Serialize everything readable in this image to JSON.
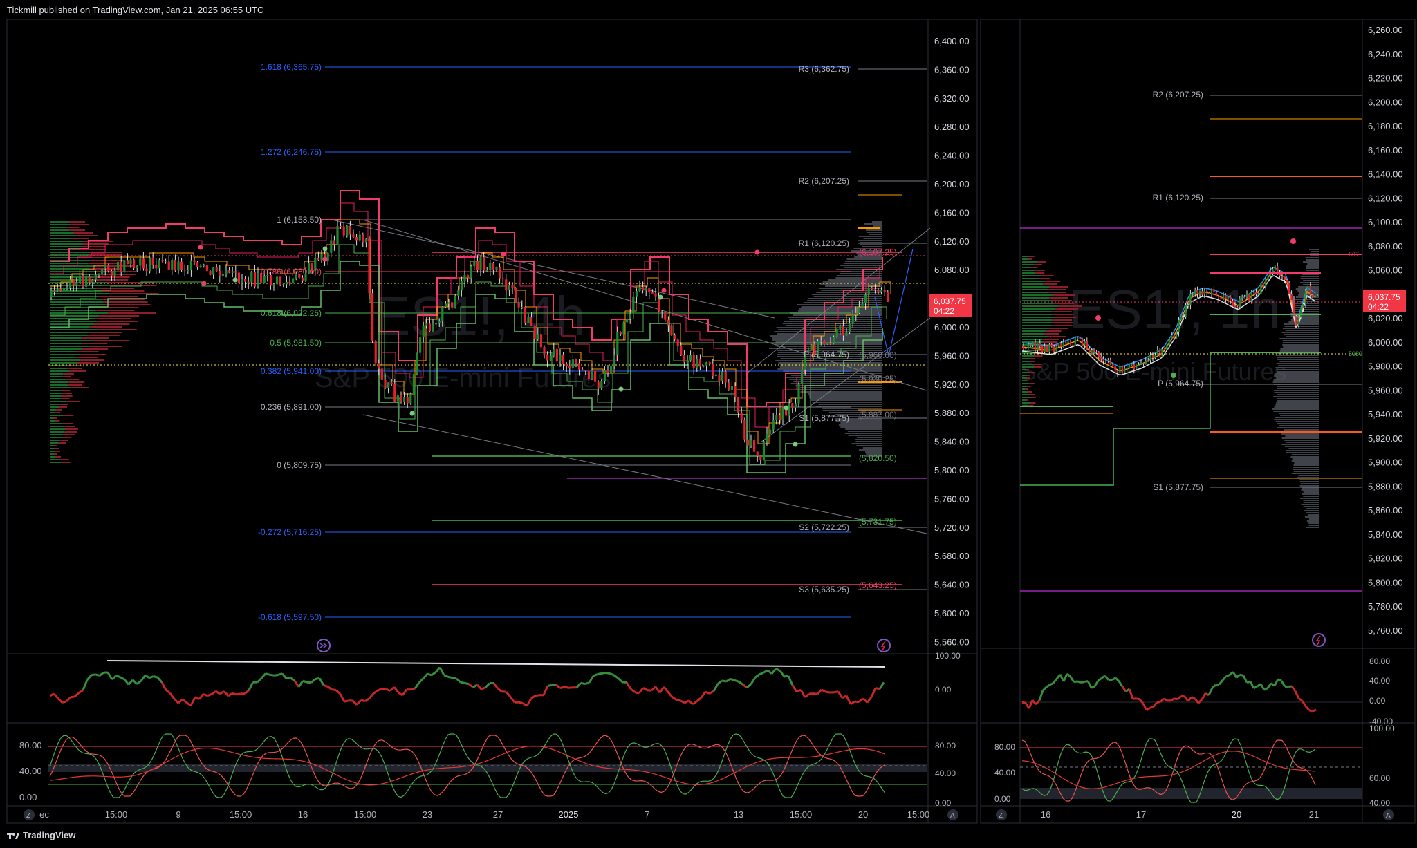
{
  "header": {
    "published_text": "Tickmill published on TradingView.com, Jan 21, 2025 06:55 UTC"
  },
  "footer": {
    "brand": "TradingView"
  },
  "colors": {
    "bull": "#1b8a2f",
    "bear": "#e8202e",
    "pink": "#f23b6b",
    "green_line": "#4caf50",
    "orange": "#ff9800",
    "blue": "#2962ff",
    "purple": "#9c27b0",
    "gray": "#787b86"
  },
  "left_chart": {
    "watermark_main": "ES1!, 4h",
    "watermark_sub": "S&P 500 E-mini Futures",
    "price_axis": [
      "6,400.00",
      "6,360.00",
      "6,320.00",
      "6,280.00",
      "6,240.00",
      "6,200.00",
      "6,160.00",
      "6,120.00",
      "6,080.00",
      "6,040.00",
      "6,000.00",
      "5,960.00",
      "5,920.00",
      "5,880.00",
      "5,840.00",
      "5,800.00",
      "5,760.00",
      "5,720.00",
      "5,680.00",
      "5,640.00",
      "5,600.00",
      "5,560.00"
    ],
    "last_price": "6,037.75",
    "countdown": "04:22",
    "fib_labels": [
      "1.618 (6,365.75)",
      "1.272 (6,246.75)",
      "1 (6,153.50)",
      "0.786 (6,080.00)",
      "0.618 (6,022.25)",
      "0.5 (5,981.50)",
      "0.382 (5,941.00)",
      "0.236 (5,891.00)",
      "0 (5,809.75)",
      "-0.272 (5,716.25)",
      "-0.618 (5,597.50)"
    ],
    "pivot_labels": [
      "R3 (6,362.75)",
      "R2 (6,207.25)",
      "R1 (6,120.25)",
      "P (5,964.75)",
      "S1 (5,877.75)",
      "S2 (5,722.25)",
      "S3 (5,635.25)"
    ],
    "level_labels": [
      "(6,107.25)",
      "(5,960.00)",
      "(5,930.25)",
      "(5,887.00)",
      "(5,820.50)",
      "(5,731.75)",
      "(5,643.25)"
    ],
    "time_axis": [
      "ec",
      "15:00",
      "9",
      "15:00",
      "16",
      "15:00",
      "23",
      "27",
      "2025",
      "7",
      "13",
      "15:00",
      "20",
      "15:00"
    ],
    "osc1_axis": [
      "100.00",
      "0.00"
    ],
    "osc2_axis": [
      "80.00",
      "40.00",
      "0.00",
      "80.00",
      "40.00",
      "0.00"
    ]
  },
  "right_chart": {
    "watermark_main": "ES1!, 1h",
    "watermark_sub": "S&P 500 E-mini Futures",
    "price_axis": [
      "6,260.00",
      "6,240.00",
      "6,220.00",
      "6,200.00",
      "6,180.00",
      "6,160.00",
      "6,140.00",
      "6,120.00",
      "6,100.00",
      "6,080.00",
      "6,060.00",
      "6,040.00",
      "6,020.00",
      "6,000.00",
      "5,980.00",
      "5,960.00",
      "5,940.00",
      "5,920.00",
      "5,900.00",
      "5,880.00",
      "5,860.00",
      "5,840.00",
      "5,820.00",
      "5,800.00",
      "5,780.00",
      "5,760.00"
    ],
    "last_price": "6,037.75",
    "countdown": "04:22",
    "pivot_labels": [
      "R2 (6,207.25)",
      "R1 (6,120.25)",
      "P (5,964.75)",
      "S1 (5,877.75)"
    ],
    "small_tags": [
      "607",
      "5989"
    ],
    "time_axis": [
      "16",
      "17",
      "20",
      "21"
    ],
    "osc1_axis": [
      "80.00",
      "40.00",
      "0.00",
      "-40.00"
    ],
    "osc2_axis": [
      "80.00",
      "40.00",
      "0.00",
      "100.00",
      "60.00",
      "40.00"
    ]
  }
}
